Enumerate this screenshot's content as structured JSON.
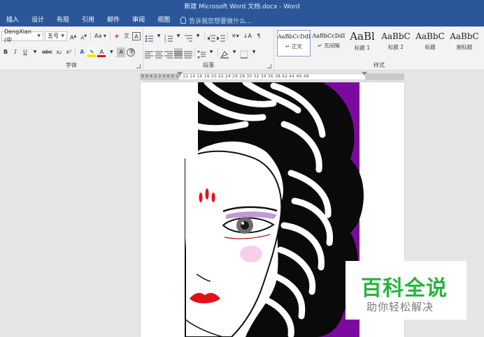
{
  "window": {
    "title": "新建 Microsoft Word 文档.docx - Word"
  },
  "tabs": [
    "插入",
    "设计",
    "布局",
    "引用",
    "邮件",
    "审阅",
    "视图"
  ],
  "tell_me": {
    "placeholder": "告诉我您想要做什么..."
  },
  "font_group": {
    "font_name": "DengXian (中",
    "font_size": "五号",
    "grow_label": "A",
    "shrink_label": "A",
    "case_label": "Aa",
    "bold_label": "B",
    "italic_label": "I",
    "underline_label": "U",
    "strike_label": "abc",
    "sub_label": "x₂",
    "sup_label": "x²",
    "effects_label": "A",
    "font_color_label": "A",
    "char_shade_label": "A",
    "label": "字体"
  },
  "paragraph_group": {
    "label": "段落"
  },
  "styles_group": {
    "label": "样式",
    "items": [
      {
        "sample": "AaBbCcDdI",
        "name": "↵ 正文"
      },
      {
        "sample": "AaBbCcDdI",
        "name": "↵ 无间隔"
      },
      {
        "sample": "AaBl",
        "name": "标题 1"
      },
      {
        "sample": "AaBbC",
        "name": "标题 2"
      },
      {
        "sample": "AaBbC",
        "name": "标题"
      },
      {
        "sample": "AaBbC",
        "name": "副标题"
      }
    ]
  },
  "ruler": {
    "numbers": "8  6  4  2     2  4  6  8  10  12  14  16  18  20  22  24  26  28  30  32  34  36  38       42  44  46  48"
  },
  "colors": {
    "accent": "#2b579a",
    "purple": "#7d0aa0",
    "lip_red": "#e3101a",
    "watermark_green": "#28b440"
  },
  "watermark": {
    "title": "百科全说",
    "subtitle": "助你轻松解决"
  }
}
